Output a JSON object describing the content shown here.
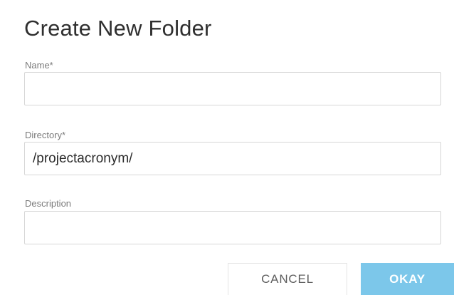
{
  "dialog": {
    "title": "Create New Folder"
  },
  "fields": {
    "name": {
      "label": "Name*",
      "value": ""
    },
    "directory": {
      "label": "Directory*",
      "value": "/projectacronym/"
    },
    "description": {
      "label": "Description",
      "value": ""
    }
  },
  "buttons": {
    "cancel_label": "CANCEL",
    "okay_label": "OKAY"
  },
  "colors": {
    "primary_button": "#7cc7ea",
    "primary_button_text": "#ffffff",
    "secondary_button_text": "#5e5e5e",
    "input_border": "#d6d6d6",
    "title_text": "#2f2f2f",
    "label_text": "#7b7b7b"
  }
}
